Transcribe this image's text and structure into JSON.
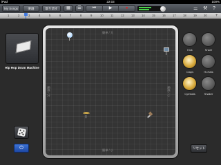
{
  "status": {
    "carrier": "iPad",
    "time": "22:03",
    "battery": "100%"
  },
  "toolbar": {
    "my_songs": "My Songs",
    "instruments_label": "楽器",
    "undo_label": "取り消す",
    "grid_icon": "grid-icon",
    "record_color": "#dd2222",
    "right_icons": [
      "mixer-icon",
      "wrench-icon",
      "info-icon"
    ]
  },
  "ruler": {
    "numbers": [
      "1",
      "2",
      "3",
      "4",
      "5",
      "6",
      "7",
      "8",
      "9",
      "10",
      "11",
      "12",
      "13",
      "14",
      "15",
      "16",
      "17",
      "18",
      "19",
      "20"
    ],
    "add": "+"
  },
  "track": {
    "name": "Hip Hop Drum Machine"
  },
  "pad": {
    "labels": {
      "top": "簡単 / 大",
      "bottom": "簡単 / 小",
      "left": "複雑 / 大",
      "right": "複雑 / 小"
    }
  },
  "drums": [
    {
      "name": "Kick",
      "active": false
    },
    {
      "name": "Snare",
      "active": false
    },
    {
      "name": "Claps",
      "active": true
    },
    {
      "name": "Hi-Hats",
      "active": false
    },
    {
      "name": "Cymbals",
      "active": true
    },
    {
      "name": "Shaker",
      "active": false
    }
  ],
  "reset_label": "リセット",
  "power_icon": "power-icon",
  "dice_icon": "dice-icon"
}
